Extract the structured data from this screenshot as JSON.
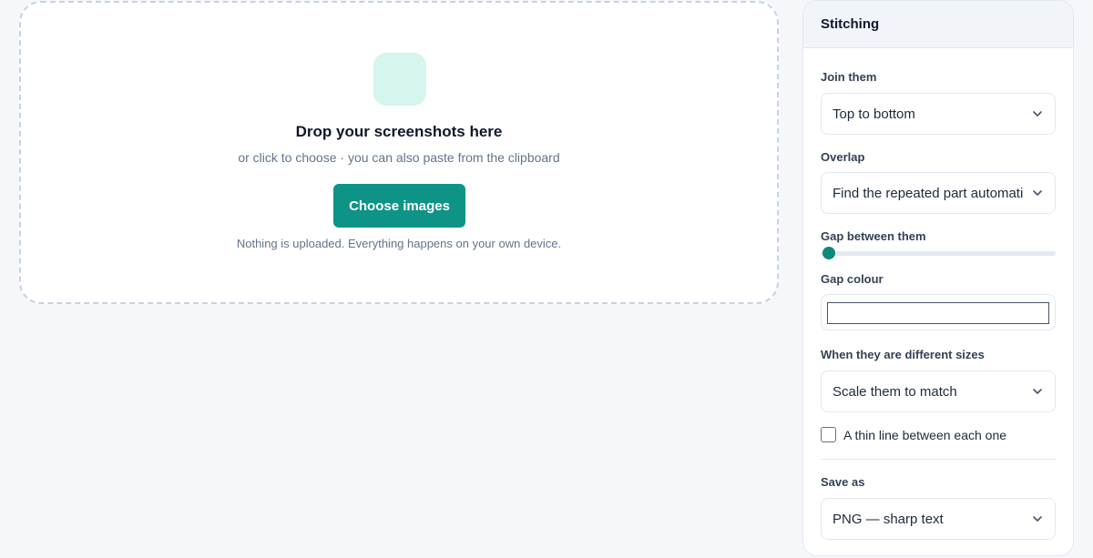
{
  "dropzone": {
    "icon": "image-placeholder-icon",
    "title": "Drop your screenshots here",
    "subtitle": "or click to choose · you can also paste from the clipboard",
    "button_label": "Choose images",
    "note": "Nothing is uploaded. Everything happens on your own device."
  },
  "panel": {
    "title": "Stitching",
    "join": {
      "label": "Join them",
      "value": "Top to bottom"
    },
    "overlap": {
      "label": "Overlap",
      "value": "Find the repeated part automatically"
    },
    "gap": {
      "label": "Gap between them",
      "value": 0
    },
    "gap_colour": {
      "label": "Gap colour",
      "value": "#ffffff"
    },
    "sizes": {
      "label": "When they are different sizes",
      "value": "Scale them to match"
    },
    "thin_line": {
      "label": "A thin line between each one",
      "checked": false
    },
    "save_as": {
      "label": "Save as",
      "value": "PNG — sharp text"
    }
  },
  "colors": {
    "accent": "#0e9486",
    "icon_bg": "#d5f5ee",
    "page_bg": "#f6f7fb"
  }
}
